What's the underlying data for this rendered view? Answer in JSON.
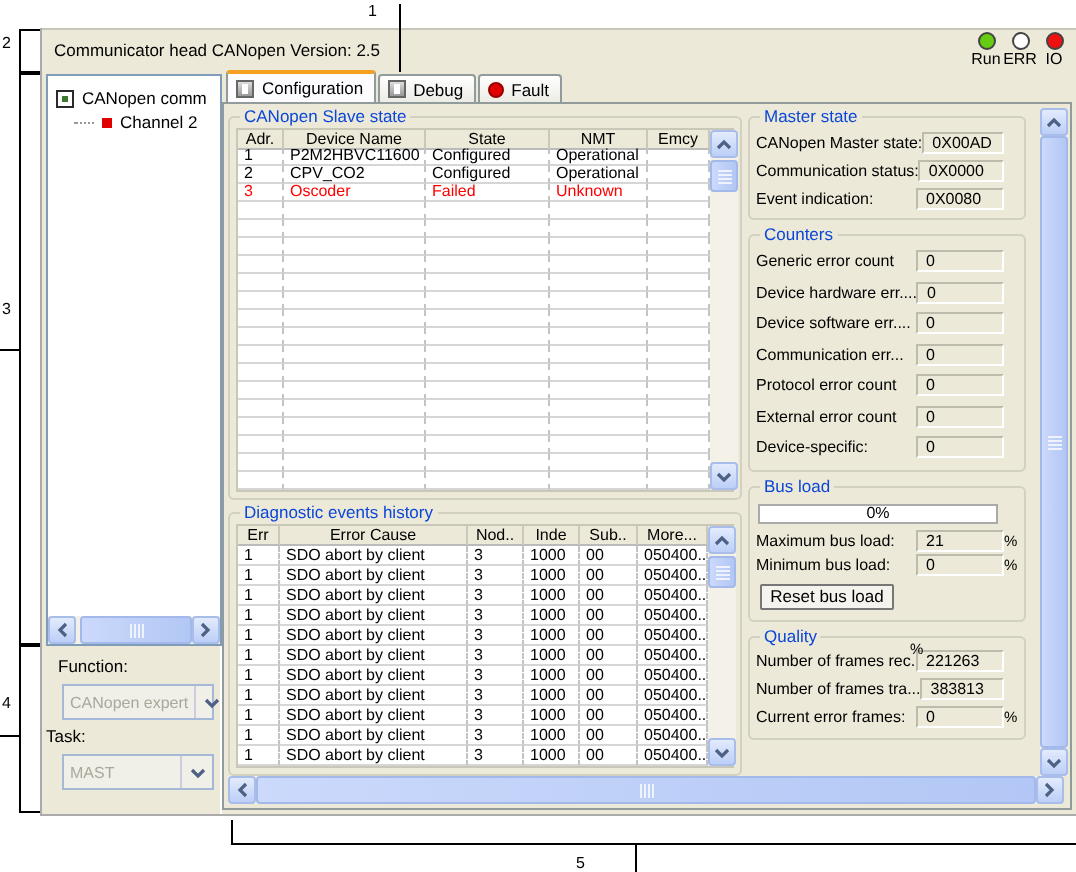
{
  "callouts": [
    "1",
    "2",
    "3",
    "4",
    "5"
  ],
  "header": {
    "title": "Communicator head CANopen Version: 2.5",
    "leds": [
      {
        "label": "Run",
        "color": "#66cc11"
      },
      {
        "label": "ERR",
        "color": "#ffffff"
      },
      {
        "label": "IO",
        "color": "#ee1111"
      }
    ]
  },
  "tree": [
    {
      "label": "CANopen comm",
      "children": [
        {
          "label": "Channel 2"
        }
      ]
    }
  ],
  "function": {
    "label": "Function:",
    "value": "CANopen expert",
    "disabled": true
  },
  "task": {
    "label": "Task:",
    "value": "MAST",
    "disabled": true
  },
  "tabs": [
    {
      "label": "Configuration",
      "selected": true,
      "fault": false
    },
    {
      "label": "Debug",
      "selected": false,
      "fault": false
    },
    {
      "label": "Fault",
      "selected": false,
      "fault": true
    }
  ],
  "slave_state": {
    "title": "CANopen Slave state",
    "columns": [
      "Adr.",
      "Device Name",
      "State",
      "NMT",
      "Emcy"
    ],
    "rows": [
      {
        "cells": [
          "1",
          "P2M2HBVC11600",
          "Configured",
          "Operational"
        ],
        "fault": false
      },
      {
        "cells": [
          "2",
          "CPV_CO2",
          "Configured",
          "Operational"
        ],
        "fault": false
      },
      {
        "cells": [
          "3",
          "Oscoder",
          "Failed",
          "Unknown"
        ],
        "fault": true
      }
    ]
  },
  "diagnostics": {
    "title": "Diagnostic events history",
    "columns": [
      "Err",
      "Error Cause",
      "Nod..",
      "Inde",
      "Sub..",
      "More..."
    ],
    "rows": [
      [
        "1",
        "SDO abort by client",
        "3",
        "1000",
        "00",
        "050400.."
      ],
      [
        "1",
        "SDO abort by client",
        "3",
        "1000",
        "00",
        "050400.."
      ],
      [
        "1",
        "SDO abort by client",
        "3",
        "1000",
        "00",
        "050400.."
      ],
      [
        "1",
        "SDO abort by client",
        "3",
        "1000",
        "00",
        "050400.."
      ],
      [
        "1",
        "SDO abort by client",
        "3",
        "1000",
        "00",
        "050400.."
      ],
      [
        "1",
        "SDO abort by client",
        "3",
        "1000",
        "00",
        "050400.."
      ],
      [
        "1",
        "SDO abort by client",
        "3",
        "1000",
        "00",
        "050400.."
      ],
      [
        "1",
        "SDO abort by client",
        "3",
        "1000",
        "00",
        "050400.."
      ],
      [
        "1",
        "SDO abort by client",
        "3",
        "1000",
        "00",
        "050400.."
      ],
      [
        "1",
        "SDO abort by client",
        "3",
        "1000",
        "00",
        "050400.."
      ],
      [
        "1",
        "SDO abort by client",
        "3",
        "1000",
        "00",
        "050400.."
      ]
    ]
  },
  "master_state": {
    "title": "Master state",
    "fields": [
      {
        "label": "CANopen Master state:",
        "value": "0X00AD"
      },
      {
        "label": "Communication status:",
        "value": "0X0000"
      },
      {
        "label": "Event indication:",
        "value": "0X0080"
      }
    ]
  },
  "counters": {
    "title": "Counters",
    "fields": [
      {
        "label": "Generic error count",
        "value": "0"
      },
      {
        "label": "Device hardware err....",
        "value": "0"
      },
      {
        "label": "Device software err....",
        "value": "0"
      },
      {
        "label": "Communication err...",
        "value": "0"
      },
      {
        "label": "Protocol error count",
        "value": "0"
      },
      {
        "label": "External error count",
        "value": "0"
      },
      {
        "label": "Device-specific:",
        "value": "0"
      }
    ]
  },
  "bus_load": {
    "title": "Bus load",
    "level": 0,
    "reading": "0%",
    "fields": [
      {
        "label": "Maximum bus load:",
        "value": "21",
        "unit": "%"
      },
      {
        "label": "Minimum bus load:",
        "value": "0",
        "unit": "%"
      }
    ],
    "reset_button": "Reset bus load"
  },
  "quality": {
    "title": "Quality",
    "stray_unit": "%",
    "fields": [
      {
        "label": "Number of frames rec.",
        "value": "221263"
      },
      {
        "label": "Number of frames tra...",
        "value": "383813"
      },
      {
        "label": "Current error frames:",
        "value": "0",
        "unit": "%"
      }
    ]
  }
}
